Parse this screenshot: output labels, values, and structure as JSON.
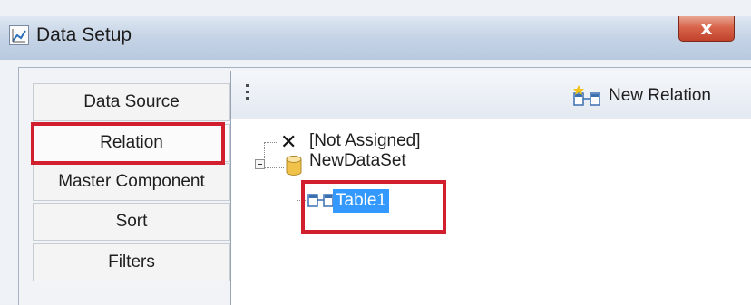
{
  "window": {
    "title": "Data Setup",
    "close_glyph": "x"
  },
  "nav": {
    "items": [
      {
        "label": "Data Source"
      },
      {
        "label": "Relation"
      },
      {
        "label": "Master Component"
      },
      {
        "label": "Sort"
      },
      {
        "label": "Filters"
      }
    ],
    "selected": "Relation"
  },
  "toolbar": {
    "new_relation_label": "New Relation",
    "icon": "relation-icon"
  },
  "tree": {
    "not_assigned_label": "[Not Assigned]",
    "dataset_label": "NewDataSet",
    "table_label": "Table1",
    "dataset_icon": "database-icon",
    "table_icon": "relation-icon"
  },
  "colors": {
    "highlight": "#d11f2e",
    "selection": "#3399ff"
  }
}
